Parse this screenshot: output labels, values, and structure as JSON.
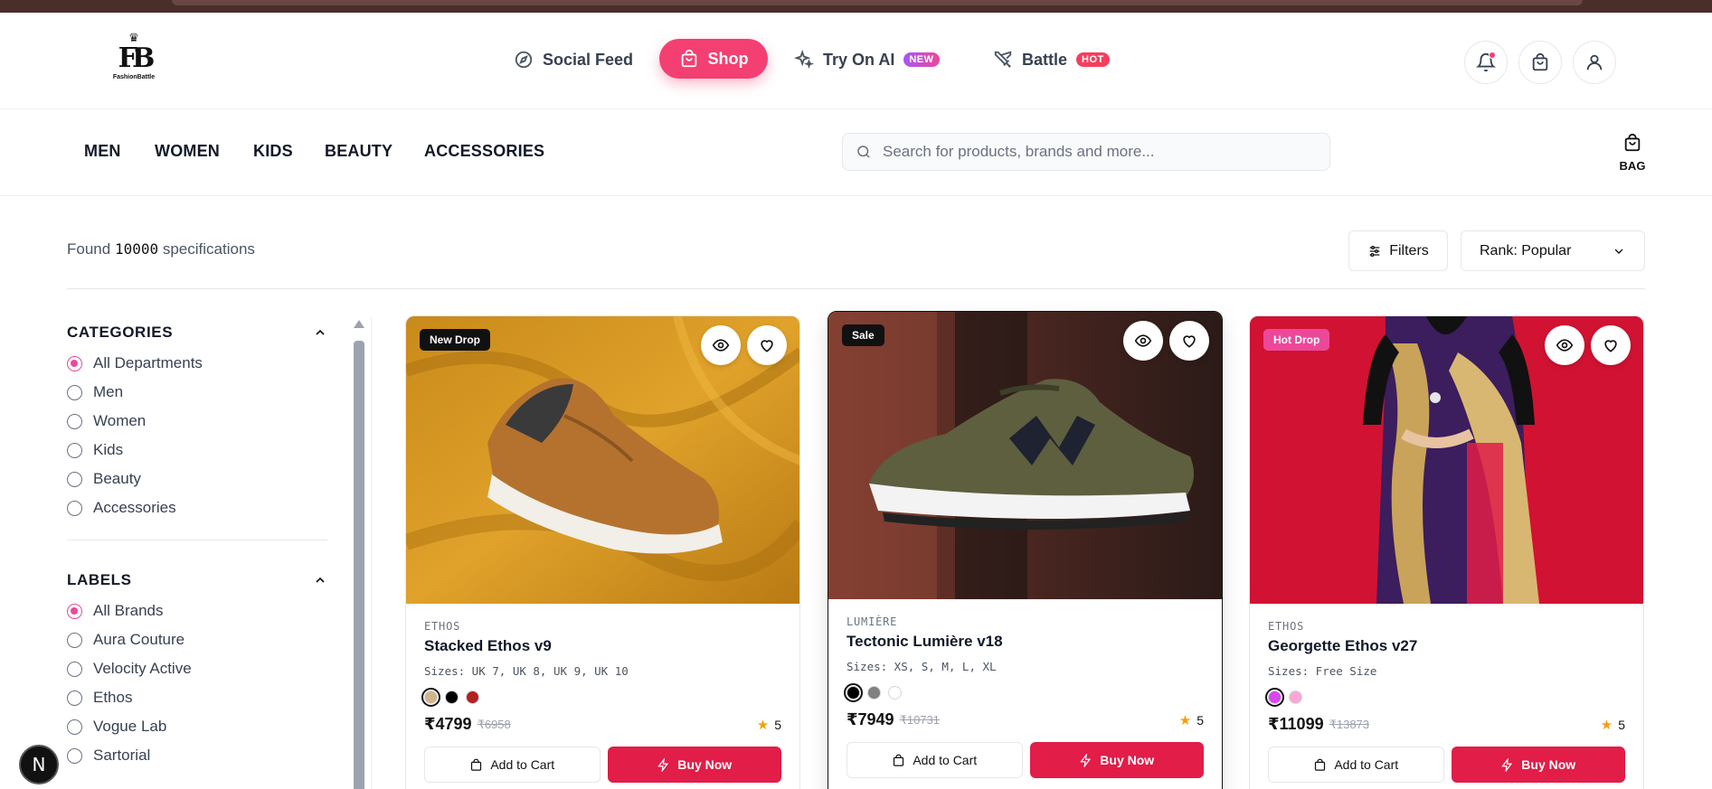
{
  "logo": {
    "crown": "♛",
    "monogram": "FB",
    "wordmark": "FashionBattle"
  },
  "nav": {
    "social_feed": "Social Feed",
    "shop": "Shop",
    "try_on_ai": "Try On AI",
    "try_on_badge": "NEW",
    "battle": "Battle",
    "battle_badge": "HOT"
  },
  "categories_nav": [
    "MEN",
    "WOMEN",
    "KIDS",
    "BEAUTY",
    "ACCESSORIES"
  ],
  "search": {
    "placeholder": "Search for products, brands and more..."
  },
  "bag": {
    "label": "BAG"
  },
  "results": {
    "prefix": "Found",
    "count": "10000",
    "suffix": "specifications"
  },
  "toolbar": {
    "filters_label": "Filters",
    "sort_label": "Rank: Popular"
  },
  "sidebar": {
    "categories_title": "CATEGORIES",
    "categories": [
      "All Departments",
      "Men",
      "Women",
      "Kids",
      "Beauty",
      "Accessories"
    ],
    "labels_title": "LABELS",
    "labels": [
      "All Brands",
      "Aura Couture",
      "Velocity Active",
      "Ethos",
      "Vogue Lab",
      "Sartorial"
    ]
  },
  "products": [
    {
      "tag": "New Drop",
      "brand": "ETHOS",
      "name": "Stacked Ethos v9",
      "sizes": "Sizes: UK 7, UK 8, UK 9, UK 10",
      "colors": [
        "#d2b48c",
        "#000000",
        "#b22222"
      ],
      "price": "₹4799",
      "mrp": "₹6958",
      "rating": "5",
      "add_to_cart": "Add to Cart",
      "buy_now": "Buy Now"
    },
    {
      "tag": "Sale",
      "brand": "LUMIÈRE",
      "name": "Tectonic Lumière v18",
      "sizes": "Sizes: XS, S, M, L, XL",
      "colors": [
        "#000000",
        "#808080",
        "#ffffff"
      ],
      "price": "₹7949",
      "mrp": "₹10731",
      "rating": "5",
      "add_to_cart": "Add to Cart",
      "buy_now": "Buy Now"
    },
    {
      "tag": "Hot Drop",
      "brand": "ETHOS",
      "name": "Georgette Ethos v27",
      "sizes": "Sizes: Free Size",
      "colors": [
        "#d946ef",
        "#f9a8d4"
      ],
      "price": "₹11099",
      "mrp": "₹13873",
      "rating": "5",
      "add_to_cart": "Add to Cart",
      "buy_now": "Buy Now"
    }
  ],
  "fab": {
    "label": "N"
  },
  "colors": {
    "accent": "#f43f72",
    "buy": "#e11d48",
    "radio_on": "#ec4899"
  }
}
